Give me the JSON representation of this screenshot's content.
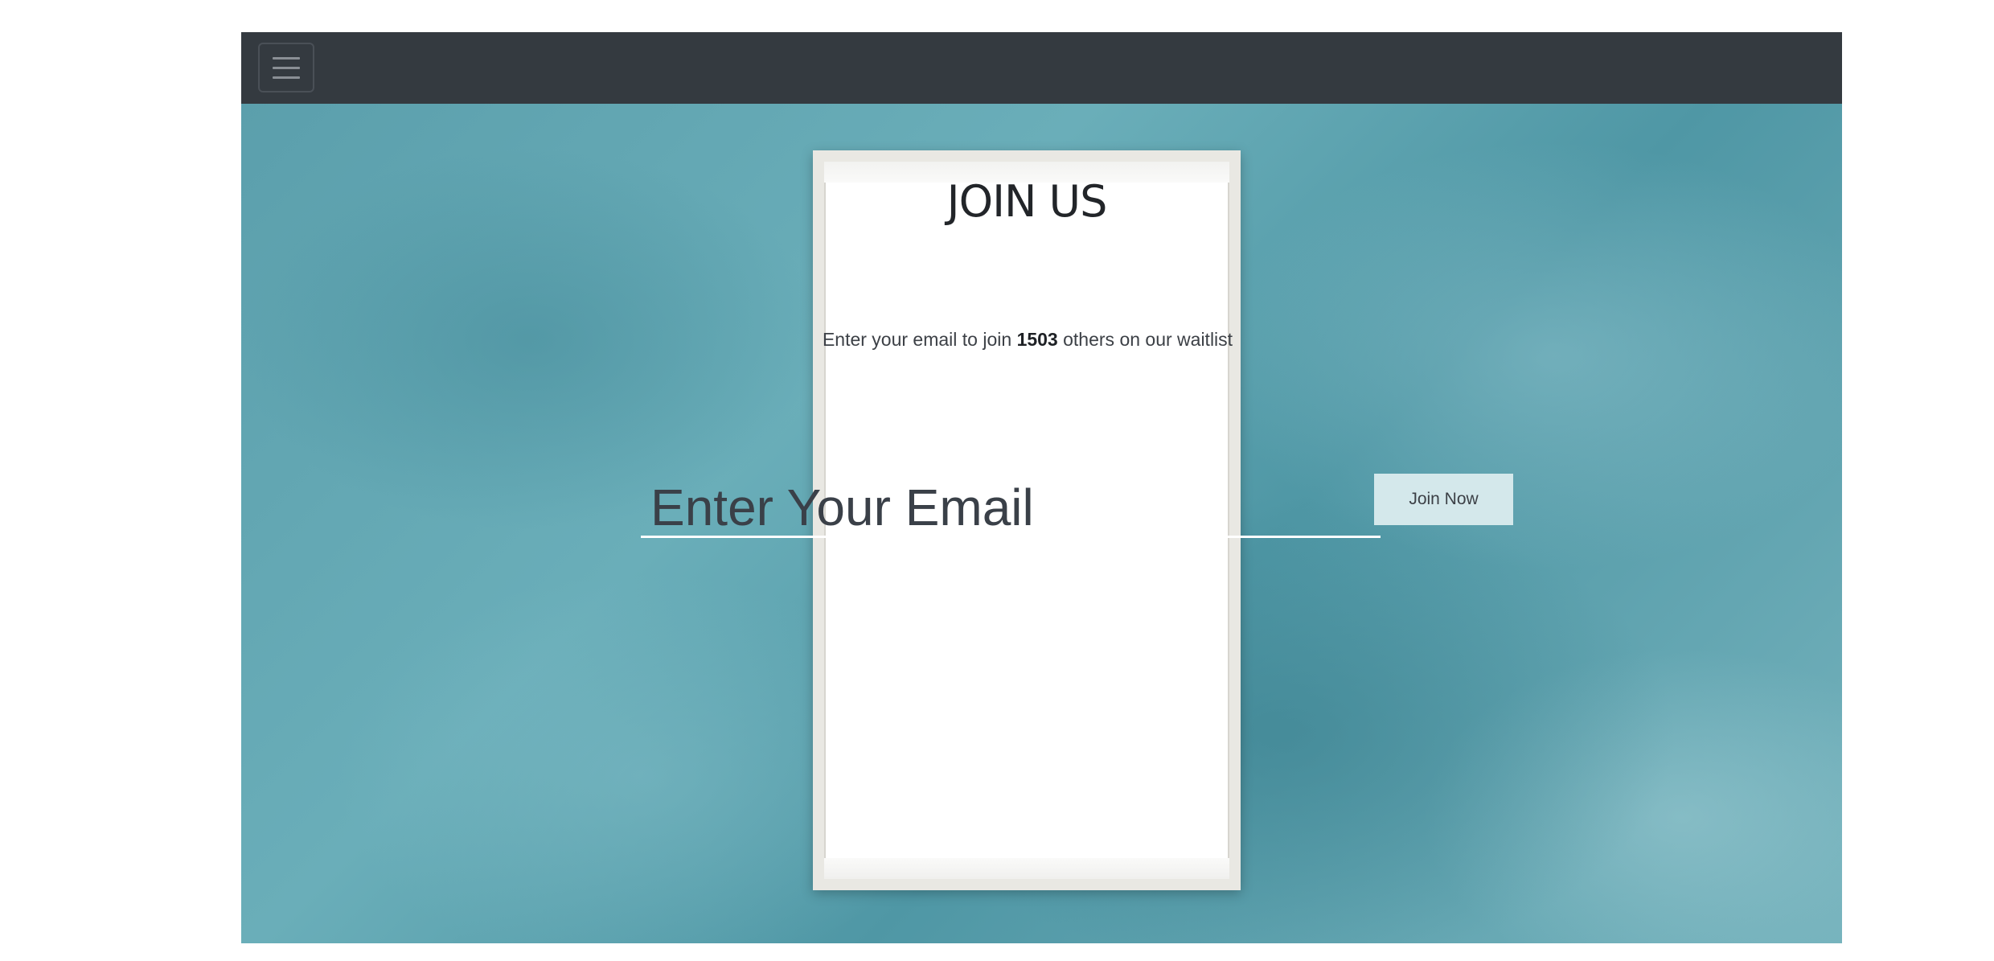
{
  "navbar": {
    "toggle_icon": "hamburger-menu-icon"
  },
  "signup": {
    "title": "JOIN US",
    "subtitle_prefix": "Enter your email to join ",
    "waitlist_count": "1503",
    "subtitle_suffix": " others on our waitlist",
    "email_placeholder": "Enter Your Email",
    "email_value": "",
    "button_label": "Join Now"
  },
  "colors": {
    "navbar_bg": "#343a40",
    "hero_bg": "#5b9fac",
    "button_bg": "#d4e8eb"
  }
}
